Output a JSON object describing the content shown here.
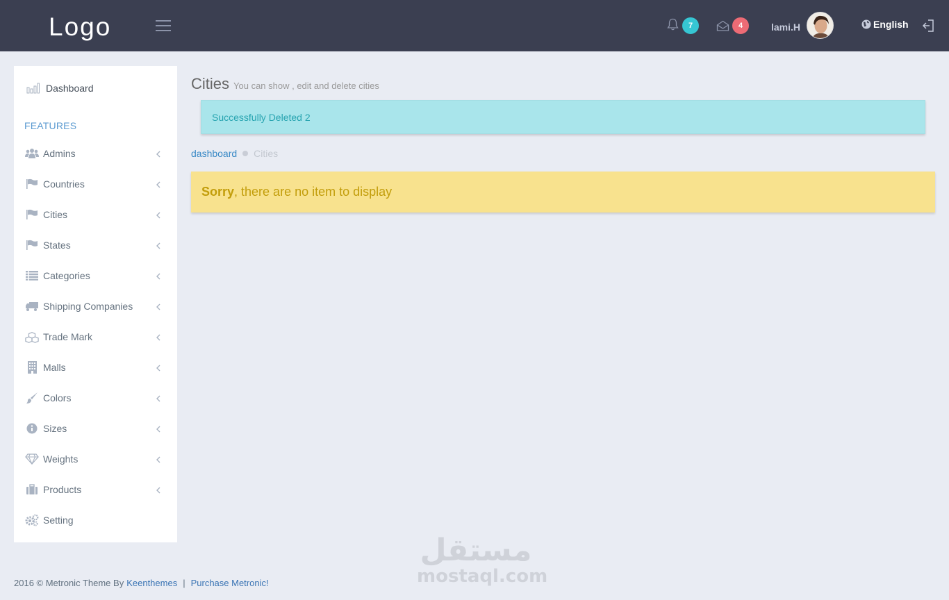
{
  "header": {
    "logo": "Logo",
    "notifications_count": "7",
    "messages_count": "4",
    "username": "lami.H",
    "language": "English",
    "accent_notifications": "#36c6d3",
    "accent_messages": "#ed6b75"
  },
  "sidebar": {
    "dashboard_label": "Dashboard",
    "section_label": "FEATURES",
    "items": [
      {
        "label": "Admins",
        "icon": "users-icon"
      },
      {
        "label": "Countries",
        "icon": "flag-icon"
      },
      {
        "label": "Cities",
        "icon": "flag-icon"
      },
      {
        "label": "States",
        "icon": "flag-icon"
      },
      {
        "label": "Categories",
        "icon": "list-icon"
      },
      {
        "label": "Shipping Companies",
        "icon": "truck-icon"
      },
      {
        "label": "Trade Mark",
        "icon": "cubes-icon"
      },
      {
        "label": "Malls",
        "icon": "building-icon"
      },
      {
        "label": "Colors",
        "icon": "paint-brush-icon"
      },
      {
        "label": "Sizes",
        "icon": "info-icon"
      },
      {
        "label": "Weights",
        "icon": "diamond-icon"
      },
      {
        "label": "Products",
        "icon": "suitcase-icon"
      },
      {
        "label": "Setting",
        "icon": "gears-icon"
      }
    ]
  },
  "main": {
    "title": "Cities",
    "subtitle": "You can show , edit and delete cities",
    "success_message": "Successfully Deleted 2",
    "breadcrumb": {
      "home": "dashboard",
      "current": "Cities"
    },
    "warning_strong": "Sorry",
    "warning_text": ", there are no item to display"
  },
  "watermark": {
    "arabic": "مستقل",
    "latin": "mostaql.com"
  },
  "footer": {
    "copyright": "2016 © Metronic Theme By",
    "author_link": "Keenthemes",
    "separator": "|",
    "purchase_link": "Purchase Metronic!"
  }
}
